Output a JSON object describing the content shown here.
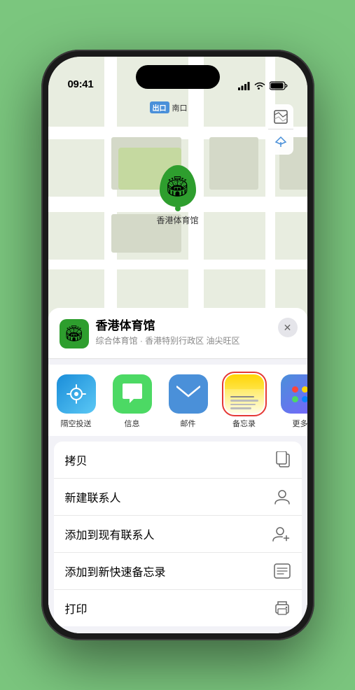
{
  "status_bar": {
    "time": "09:41",
    "location_arrow": true
  },
  "map": {
    "label_badge": "出口",
    "label_text": "南口",
    "stadium_name": "香港体育馆",
    "controls": [
      "map-type-icon",
      "location-icon"
    ]
  },
  "location_card": {
    "name": "香港体育馆",
    "subtitle": "综合体育馆 · 香港特别行政区 油尖旺区",
    "close_label": "×"
  },
  "share_items": [
    {
      "id": "airdrop",
      "label": "隔空投送",
      "type": "airdrop"
    },
    {
      "id": "messages",
      "label": "信息",
      "type": "messages"
    },
    {
      "id": "mail",
      "label": "邮件",
      "type": "mail"
    },
    {
      "id": "notes",
      "label": "备忘录",
      "type": "notes"
    },
    {
      "id": "more",
      "label": "更多",
      "type": "more"
    }
  ],
  "action_items": [
    {
      "id": "copy",
      "label": "拷贝",
      "icon": "📋"
    },
    {
      "id": "new-contact",
      "label": "新建联系人",
      "icon": "👤"
    },
    {
      "id": "add-contact",
      "label": "添加到现有联系人",
      "icon": "👥"
    },
    {
      "id": "quick-note",
      "label": "添加到新快速备忘录",
      "icon": "🗒"
    },
    {
      "id": "print",
      "label": "打印",
      "icon": "🖨"
    }
  ]
}
